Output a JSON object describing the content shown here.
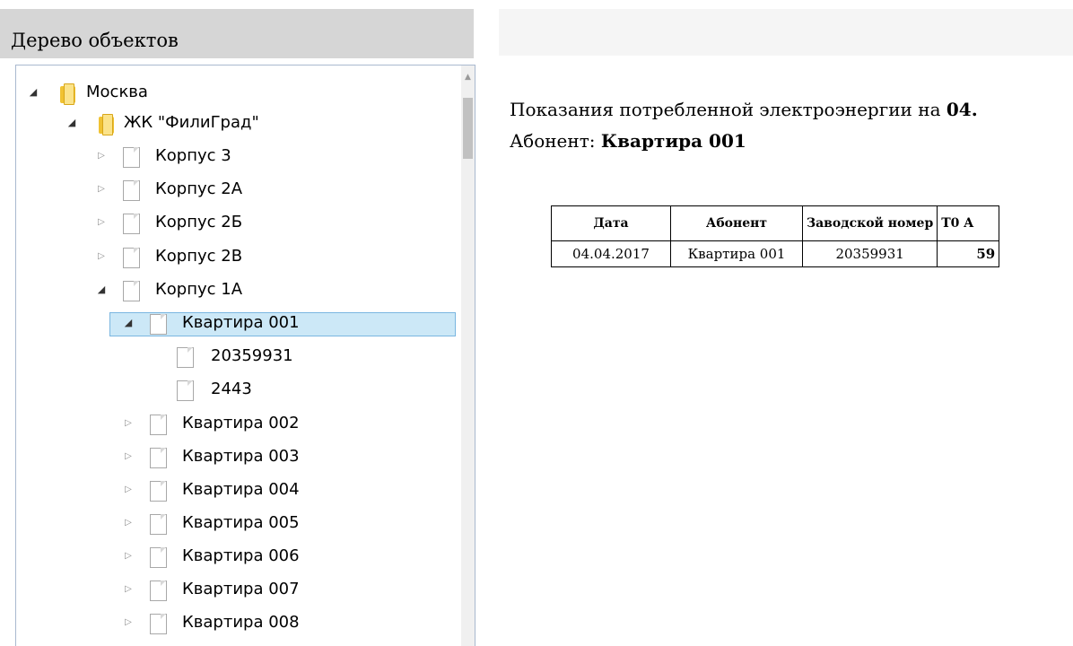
{
  "tree_panel": {
    "title": "Дерево объектов",
    "nodes": [
      {
        "label": "Москва",
        "icon": "folder-icon",
        "expander": "expanded"
      },
      {
        "label": "ЖК \"ФилиГрад\"",
        "icon": "folder-icon",
        "expander": "expanded"
      },
      {
        "label": "Корпус 3",
        "icon": "document-icon",
        "expander": "collapsed"
      },
      {
        "label": "Корпус 2А",
        "icon": "document-icon",
        "expander": "collapsed"
      },
      {
        "label": "Корпус 2Б",
        "icon": "document-icon",
        "expander": "collapsed"
      },
      {
        "label": "Корпус 2В",
        "icon": "document-icon",
        "expander": "collapsed"
      },
      {
        "label": "Корпус 1А",
        "icon": "document-icon",
        "expander": "expanded"
      },
      {
        "label": "Квартира 001",
        "icon": "document-icon",
        "expander": "expanded",
        "selected": true
      },
      {
        "label": "20359931",
        "icon": "document-icon",
        "expander": "none"
      },
      {
        "label": "2443",
        "icon": "document-icon",
        "expander": "none"
      },
      {
        "label": "Квартира 002",
        "icon": "document-icon",
        "expander": "collapsed"
      },
      {
        "label": "Квартира 003",
        "icon": "document-icon",
        "expander": "collapsed"
      },
      {
        "label": "Квартира 004",
        "icon": "document-icon",
        "expander": "collapsed"
      },
      {
        "label": "Квартира 005",
        "icon": "document-icon",
        "expander": "collapsed"
      },
      {
        "label": "Квартира 006",
        "icon": "document-icon",
        "expander": "collapsed"
      },
      {
        "label": "Квартира 007",
        "icon": "document-icon",
        "expander": "collapsed"
      },
      {
        "label": "Квартира 008",
        "icon": "document-icon",
        "expander": "collapsed"
      }
    ]
  },
  "report": {
    "title_prefix": "Показания потребленной электроэнергии на ",
    "title_date": "04.",
    "subscriber_label": "Абонент: ",
    "subscriber_value": "Квартира 001",
    "table": {
      "headers": [
        "Дата",
        "Абонент",
        "Заводской номер",
        "T0 A"
      ],
      "rows": [
        [
          "04.04.2017",
          "Квартира 001",
          "20359931",
          "59"
        ]
      ]
    }
  },
  "colors": {
    "header_bg": "#d6d6d6",
    "selection_bg": "#cce8f7",
    "selection_border": "#7ab6e0",
    "folder_yellow": "#f0c232",
    "panel_border": "#a9b9cf"
  }
}
